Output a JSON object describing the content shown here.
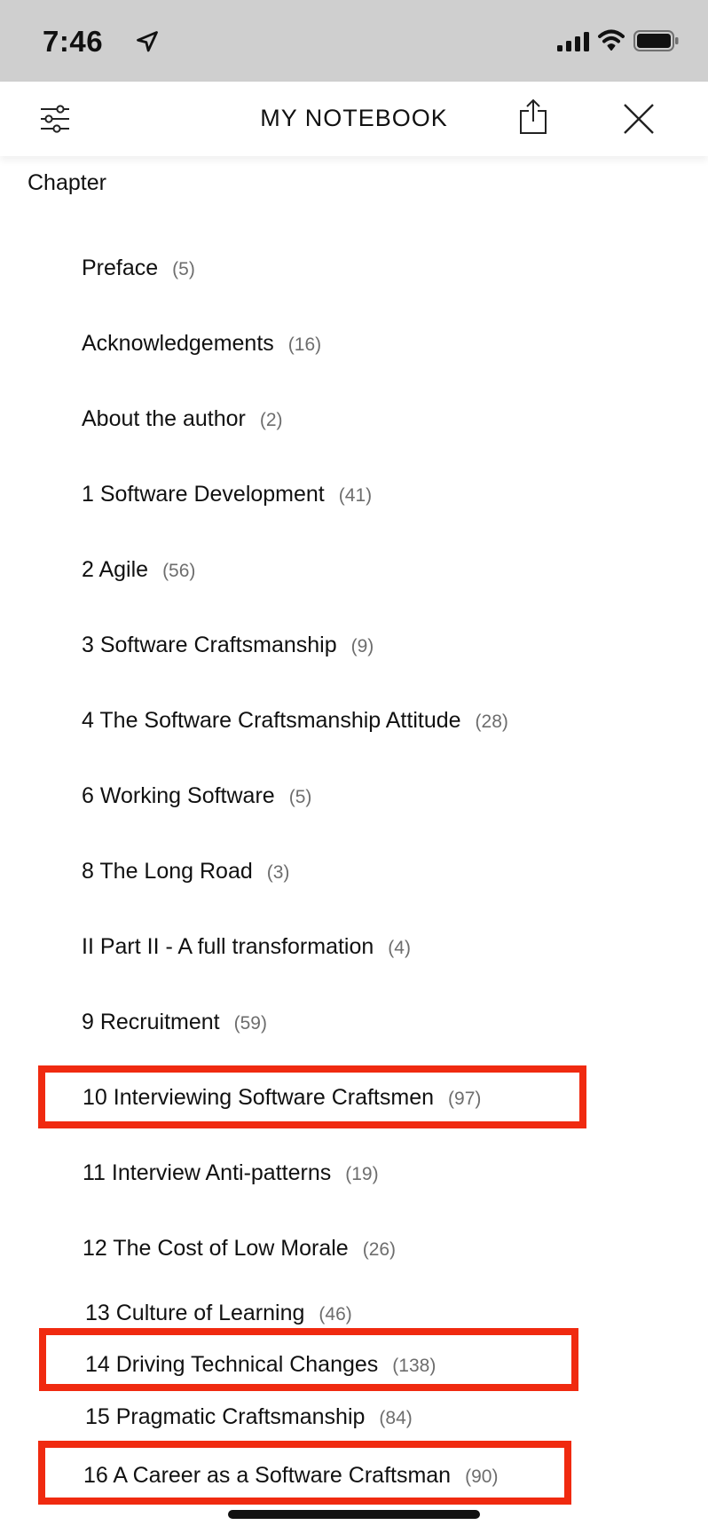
{
  "status_bar": {
    "time": "7:46",
    "icons": [
      "location-arrow-icon",
      "cellular-signal-icon",
      "wifi-icon",
      "battery-icon"
    ]
  },
  "header": {
    "title": "MY NOTEBOOK",
    "icons": [
      "filter-sliders-icon",
      "share-icon",
      "close-icon"
    ]
  },
  "section_label": "Chapter",
  "chapters": [
    {
      "title": "Preface",
      "count": "(5)"
    },
    {
      "title": "Acknowledgements",
      "count": "(16)"
    },
    {
      "title": "About the author",
      "count": "(2)"
    },
    {
      "title": "1 Software Development",
      "count": "(41)"
    },
    {
      "title": "2 Agile",
      "count": "(56)"
    },
    {
      "title": "3 Software Craftsmanship",
      "count": "(9)"
    },
    {
      "title": "4 The Software Craftsmanship Attitude",
      "count": "(28)"
    },
    {
      "title": "6 Working Software",
      "count": "(5)"
    },
    {
      "title": "8 The Long Road",
      "count": "(3)"
    },
    {
      "title": "II Part II - A full transformation",
      "count": "(4)"
    },
    {
      "title": "9 Recruitment",
      "count": "(59)"
    },
    {
      "title": "10 Interviewing Software Craftsmen",
      "count": "(97)",
      "highlighted": true
    },
    {
      "title": "11 Interview Anti-patterns",
      "count": "(19)"
    },
    {
      "title": "12 The Cost of Low Morale",
      "count": "(26)"
    },
    {
      "title": "13 Culture of Learning",
      "count": "(46)"
    },
    {
      "title": "14 Driving Technical Changes",
      "count": "(138)",
      "highlighted": true
    },
    {
      "title": "15 Pragmatic Craftsmanship",
      "count": "(84)"
    },
    {
      "title": "16 A Career as a Software Craftsman",
      "count": "(90)",
      "highlighted": true
    }
  ],
  "colors": {
    "status_bar_bg": "#cfcfcf",
    "highlight_border": "#f02a10",
    "count_text": "#6d6d6d"
  }
}
